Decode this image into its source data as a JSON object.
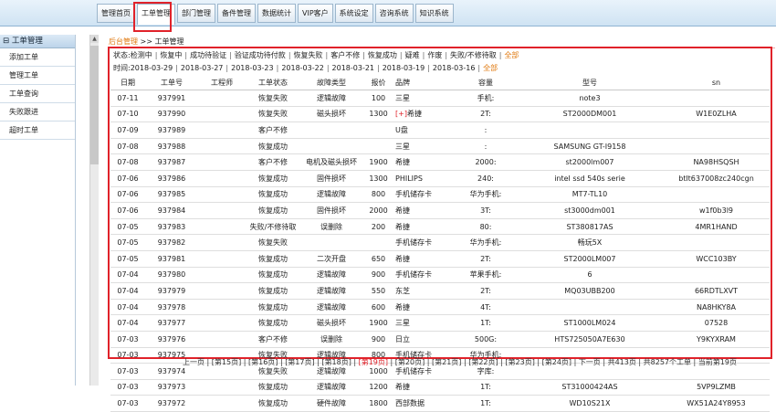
{
  "nav": {
    "tabs": [
      "管理首页",
      "工单管理",
      "部门管理",
      "备件管理",
      "数据统计",
      "VIP客户",
      "系统设定",
      "咨询系统",
      "知识系统"
    ],
    "active": 1
  },
  "sidebar": {
    "title": "工单管理",
    "items": [
      "添加工单",
      "管理工单",
      "工单查询",
      "失败跟进",
      "超时工单"
    ]
  },
  "breadcrumb": {
    "home": "后台管理",
    "sep": ">>",
    "current": "工单管理"
  },
  "status_filter": {
    "label": "状态:",
    "options": [
      "检测中",
      "恢复中",
      "成功待验证",
      "验证成功待付款",
      "恢复失败",
      "客户不修",
      "恢复成功",
      "疑难",
      "作废",
      "失败/不修待取"
    ],
    "all": "全部"
  },
  "time_filter": {
    "label": "时间:",
    "options": [
      "2018-03-29",
      "2018-03-27",
      "2018-03-23",
      "2018-03-22",
      "2018-03-21",
      "2018-03-19",
      "2018-03-16"
    ],
    "all": "全部"
  },
  "table": {
    "headers": [
      "日期",
      "工单号",
      "工程师",
      "工单状态",
      "故障类型",
      "报价",
      "品牌",
      "容量",
      "型号",
      "sn"
    ],
    "rows": [
      [
        "07-11",
        "937991",
        "",
        "恢复失败",
        "逻辑故障",
        "100",
        "三星",
        "手机:",
        "note3",
        ""
      ],
      [
        "07-10",
        "937990",
        "",
        "恢复失败",
        "磁头损坏",
        "1300",
        "[+]希捷",
        "2T:",
        "ST2000DM001",
        "W1E0ZLHA"
      ],
      [
        "07-09",
        "937989",
        "",
        "客户不修",
        "",
        "",
        "U盘",
        ":",
        "",
        ""
      ],
      [
        "07-08",
        "937988",
        "",
        "恢复成功",
        "",
        "",
        "三星",
        ":",
        "SAMSUNG GT-I9158",
        ""
      ],
      [
        "07-08",
        "937987",
        "",
        "客户不修",
        "电机及磁头损坏",
        "1900",
        "希捷",
        "2000:",
        "st2000lm007",
        "NA98HSQSH"
      ],
      [
        "07-06",
        "937986",
        "",
        "恢复成功",
        "固件损坏",
        "1300",
        "PHILIPS",
        "240:",
        "intel ssd 540s serie",
        "btlt637008zc240cgn"
      ],
      [
        "07-06",
        "937985",
        "",
        "恢复成功",
        "逻辑故障",
        "800",
        "手机储存卡",
        "华为手机:",
        "MT7-TL10",
        ""
      ],
      [
        "07-06",
        "937984",
        "",
        "恢复成功",
        "固件损坏",
        "2000",
        "希捷",
        "3T:",
        "st3000dm001",
        "w1f0b3l9"
      ],
      [
        "07-05",
        "937983",
        "",
        "失败/不修待取",
        "误删除",
        "200",
        "希捷",
        "80:",
        "ST380817AS",
        "4MR1HAND"
      ],
      [
        "07-05",
        "937982",
        "",
        "恢复失败",
        "",
        "",
        "手机储存卡",
        "华为手机:",
        "畅玩5X",
        ""
      ],
      [
        "07-05",
        "937981",
        "",
        "恢复成功",
        "二次开盘",
        "650",
        "希捷",
        "2T:",
        "ST2000LM007",
        "WCC103BY"
      ],
      [
        "07-04",
        "937980",
        "",
        "恢复成功",
        "逻辑故障",
        "900",
        "手机储存卡",
        "苹果手机:",
        "6",
        ""
      ],
      [
        "07-04",
        "937979",
        "",
        "恢复成功",
        "逻辑故障",
        "550",
        "东芝",
        "2T:",
        "MQ03UBB200",
        "66RDTLXVT"
      ],
      [
        "07-04",
        "937978",
        "",
        "恢复成功",
        "逻辑故障",
        "600",
        "希捷",
        "4T:",
        "",
        "NA8HKY8A"
      ],
      [
        "07-04",
        "937977",
        "",
        "恢复成功",
        "磁头损坏",
        "1900",
        "三星",
        "1T:",
        "ST1000LM024",
        "07528"
      ],
      [
        "07-03",
        "937976",
        "",
        "客户不修",
        "误删除",
        "900",
        "日立",
        "500G:",
        "HTS725050A7E630",
        "Y9KYXRAM"
      ],
      [
        "07-03",
        "937975",
        "",
        "恢复失败",
        "逻辑故障",
        "800",
        "手机储存卡",
        "华为手机:",
        "",
        ""
      ],
      [
        "07-03",
        "937974",
        "",
        "恢复失败",
        "逻辑故障",
        "1000",
        "手机储存卡",
        "字库:",
        "",
        ""
      ],
      [
        "07-03",
        "937973",
        "",
        "恢复成功",
        "逻辑故障",
        "1200",
        "希捷",
        "1T:",
        "ST31000424AS",
        "5VP9LZMB"
      ],
      [
        "07-03",
        "937972",
        "",
        "恢复成功",
        "硬件故障",
        "1800",
        "西部数据",
        "1T:",
        "WD10S21X",
        "WX51A24Y8953"
      ]
    ]
  },
  "pager": {
    "items": [
      "上一页",
      "[第15页]",
      "[第16页]",
      "[第17页]",
      "[第18页]",
      "[第19页]",
      "[第20页]",
      "[第21页]",
      "[第22页]",
      "[第23页]",
      "[第24页]",
      "下一页",
      "共413页",
      "共8257个工单",
      "当前第19页"
    ],
    "current_index": 5
  },
  "colors": {
    "accent_red": "#e0222a",
    "link_orange": "#e07a10"
  }
}
